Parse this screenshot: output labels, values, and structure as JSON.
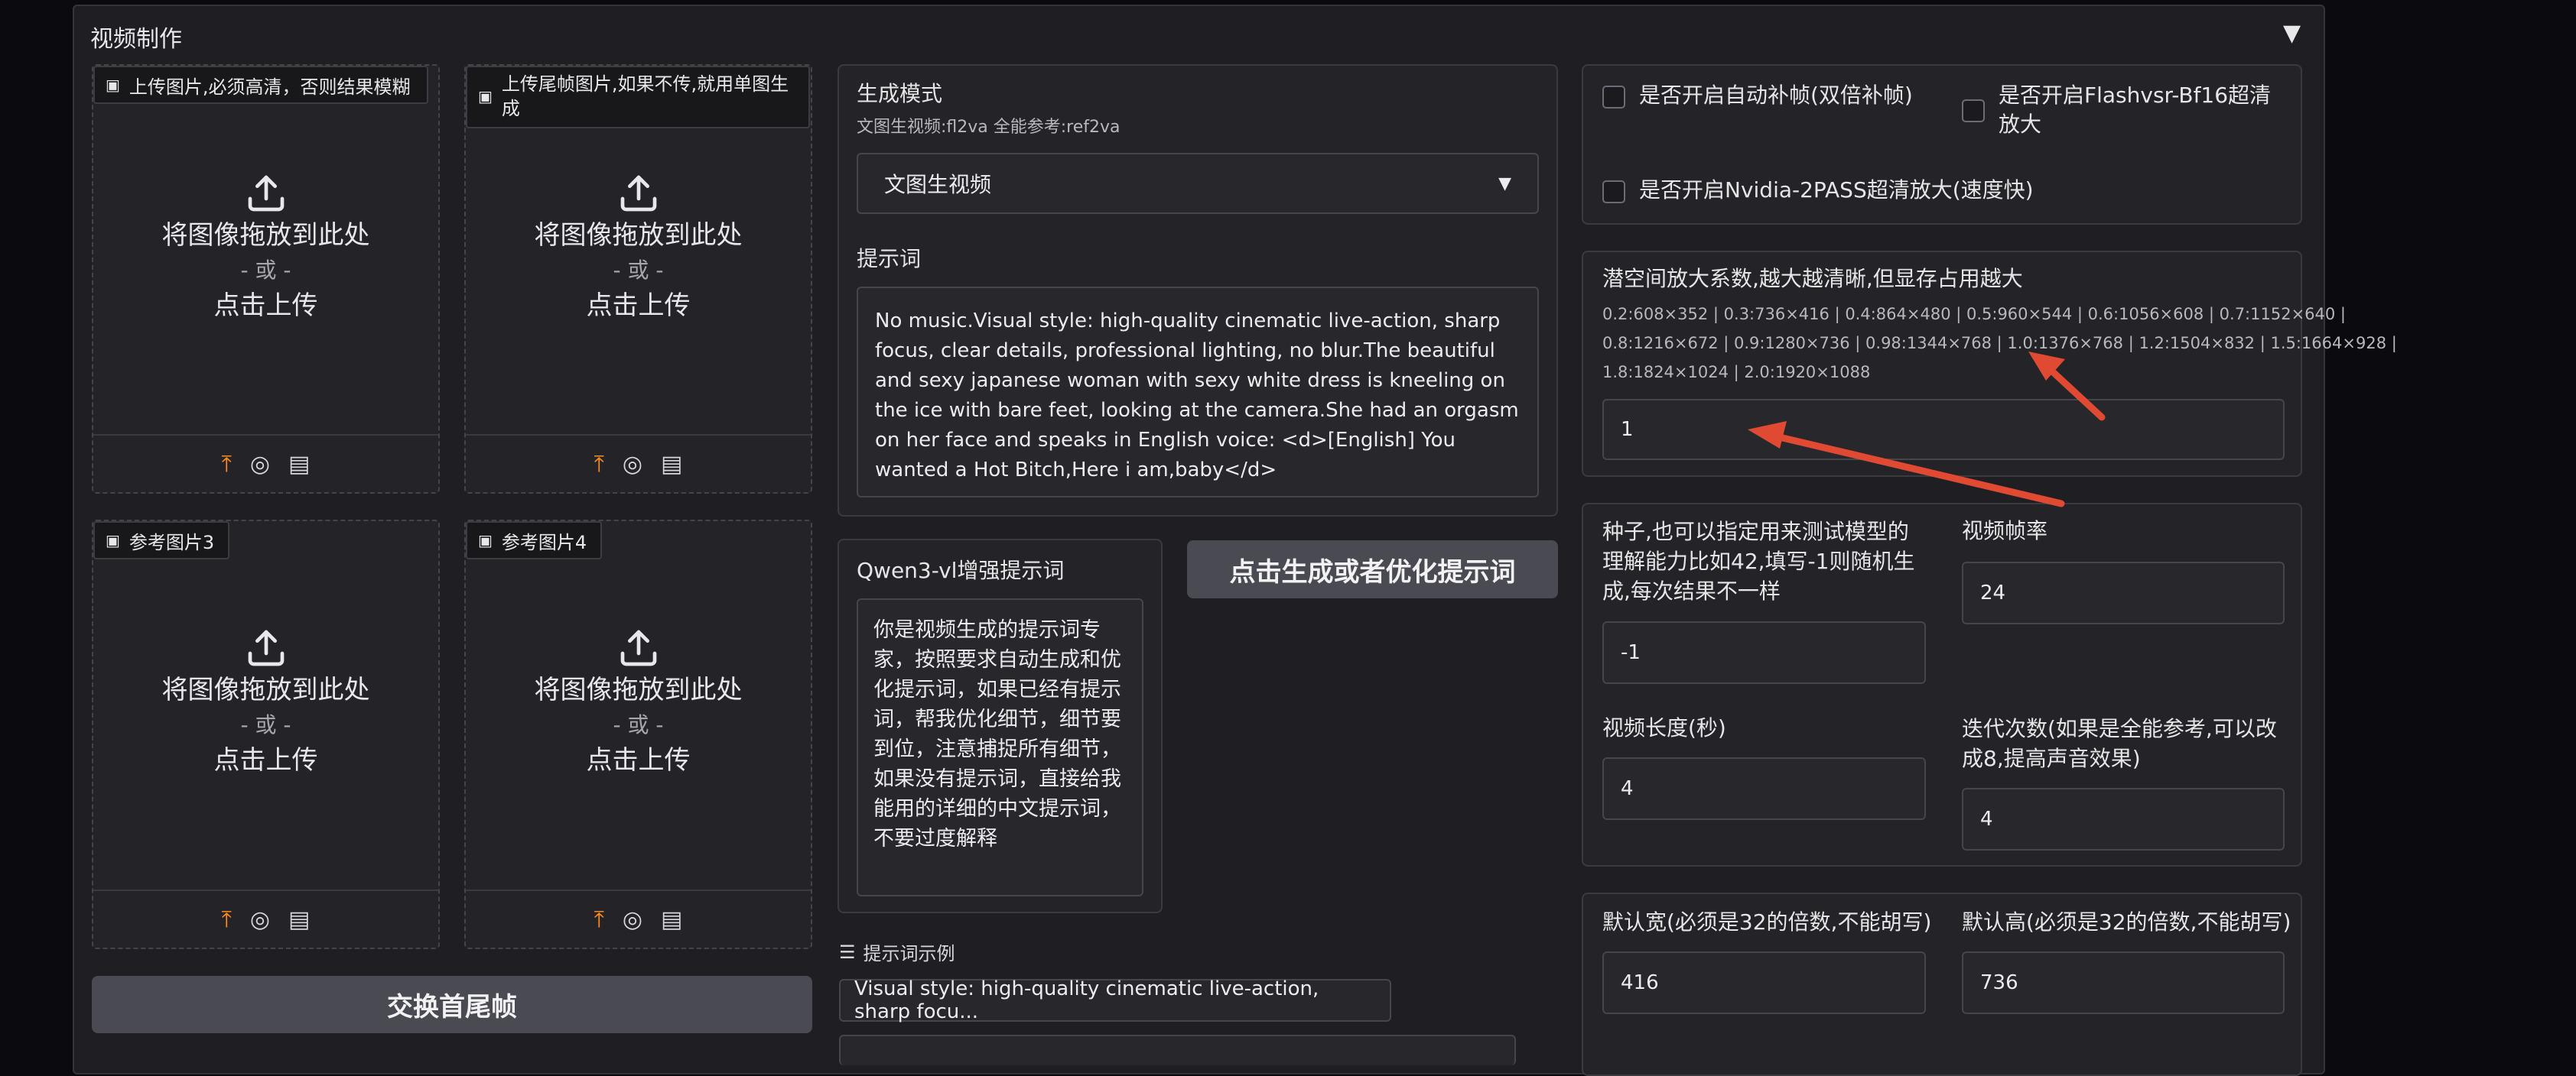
{
  "section": {
    "title": "视频制作",
    "collapse_glyph": "▼"
  },
  "uploads": [
    {
      "tag": "上传图片,必须高清，否则结果模糊"
    },
    {
      "tag": "上传尾帧图片,如果不传,就用单图生成"
    },
    {
      "tag": "参考图片3"
    },
    {
      "tag": "参考图片4"
    }
  ],
  "upload_area": {
    "drop_text": "将图像拖放到此处",
    "or_text": "- 或 -",
    "click_text": "点击上传"
  },
  "swap_button": "交换首尾帧",
  "mode": {
    "label": "生成模式",
    "info": "文图生视频:fl2va 全能参考:ref2va",
    "selected": "文图生视频"
  },
  "prompt": {
    "label": "提示词",
    "value": "No music.Visual style: high-quality cinematic live-action, sharp focus, clear details, professional lighting, no blur.The beautiful and sexy japanese woman with sexy white dress is kneeling on the ice with bare feet, looking at the camera.She had an orgasm on her face and speaks in English voice: <d>[English] You wanted a Hot Bitch,Here i am,baby</d>"
  },
  "qwen": {
    "label": "Qwen3-vl增强提示词",
    "value": "你是视频生成的提示词专家，按照要求自动生成和优化提示词，如果已经有提示词，帮我优化细节，细节要到位，注意捕捉所有细节，如果没有提示词，直接给我能用的详细的中文提示词，不要过度解释"
  },
  "optimize_button": "点击生成或者优化提示词",
  "examples": {
    "label": "提示词示例",
    "first": "Visual style: high-quality cinematic live-action, sharp focu..."
  },
  "checkboxes": {
    "auto_frame": "是否开启自动补帧(双倍补帧)",
    "flashvsr": "是否开启Flashvsr-Bf16超清放大",
    "nvidia": "是否开启Nvidia-2PASS超清放大(速度快)"
  },
  "latent": {
    "label": "潜空间放大系数,越大越清晰,但显存占用越大",
    "info_line1": "0.2:608×352 | 0.3:736×416 | 0.4:864×480 | 0.5:960×544 | 0.6:1056×608 | 0.7:1152×640 |",
    "info_line2": "0.8:1216×672 | 0.9:1280×736 | 0.98:1344×768 | 1.0:1376×768 | 1.2:1504×832 | 1.5:1664×928 |",
    "info_line3": "1.8:1824×1024 | 2.0:1920×1088",
    "value": "1"
  },
  "seed": {
    "label": "种子,也可以指定用来测试模型的理解能力比如42,填写-1则随机生成,每次结果不一样",
    "value": "-1"
  },
  "fps": {
    "label": "视频帧率",
    "value": "24"
  },
  "length": {
    "label": "视频长度(秒)",
    "value": "4"
  },
  "steps": {
    "label": "迭代次数(如果是全能参考,可以改成8,提高声音效果)",
    "value": "4"
  },
  "width": {
    "label": "默认宽(必须是32的倍数,不能胡写)",
    "value": "416"
  },
  "height": {
    "label": "默认高(必须是32的倍数,不能胡写)",
    "value": "736"
  },
  "colors": {
    "accent_orange": "#ff8a1f",
    "annotation_red": "#e04a33"
  }
}
